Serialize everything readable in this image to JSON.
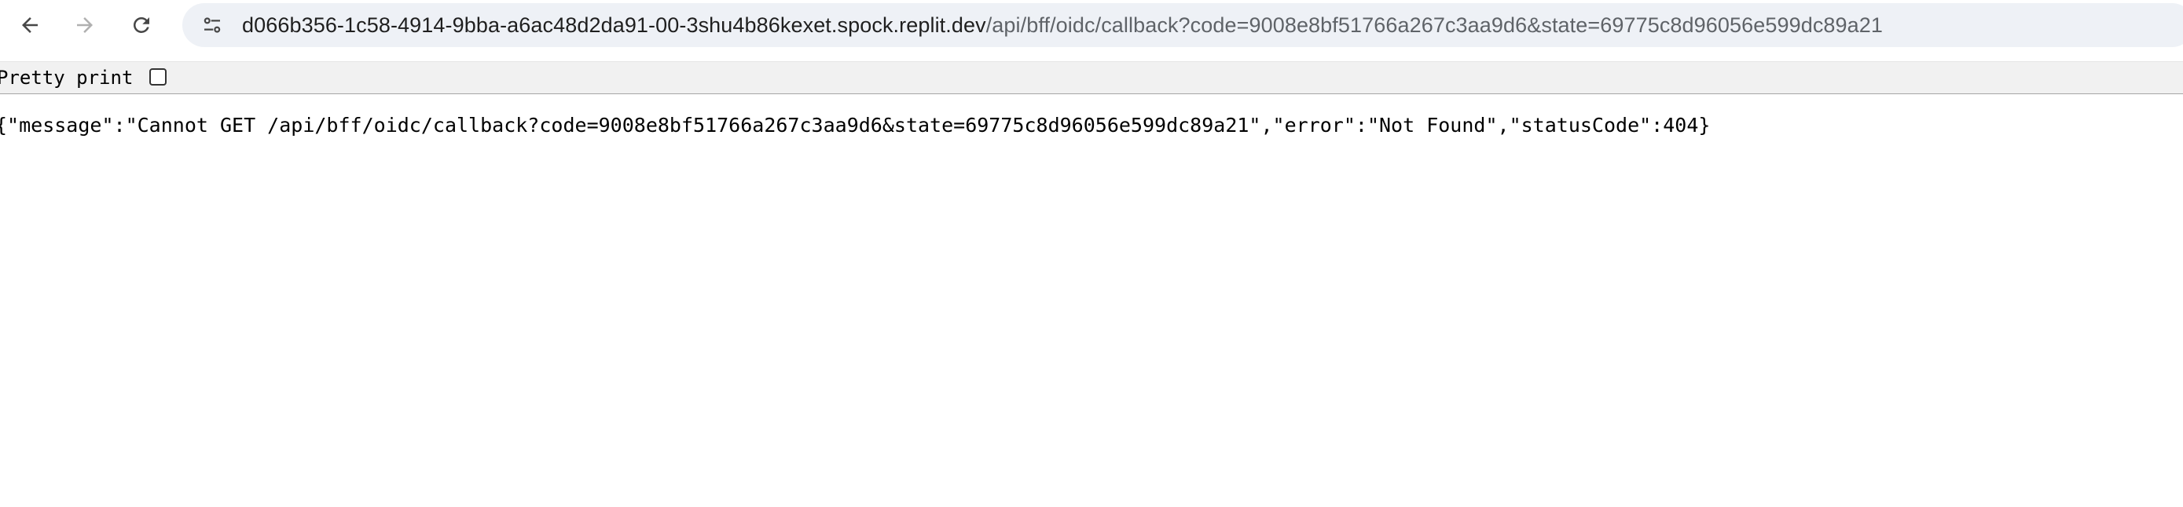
{
  "browser": {
    "back_icon": "arrow-left-icon",
    "forward_icon": "arrow-right-icon",
    "reload_icon": "reload-icon",
    "site_info_icon": "tune-icon",
    "address_bar": {
      "host": "d066b356-1c58-4914-9bba-a6ac48d2da91-00-3shu4b86kexet.spock.replit.dev",
      "path": "/api/bff/oidc/callback?code=9008e8bf51766a267c3aa9d6&state=69775c8d96056e599dc89a21"
    }
  },
  "json_viewer": {
    "pretty_print_label": "Pretty print",
    "pretty_print_checked": false,
    "body": "{\"message\":\"Cannot GET /api/bff/oidc/callback?code=9008e8bf51766a267c3aa9d6&state=69775c8d96056e599dc89a21\",\"error\":\"Not Found\",\"statusCode\":404}"
  },
  "colors": {
    "omnibox_bg": "#eef1f6",
    "pretty_print_bar_bg": "#f1f1f1",
    "text": "#000000"
  }
}
